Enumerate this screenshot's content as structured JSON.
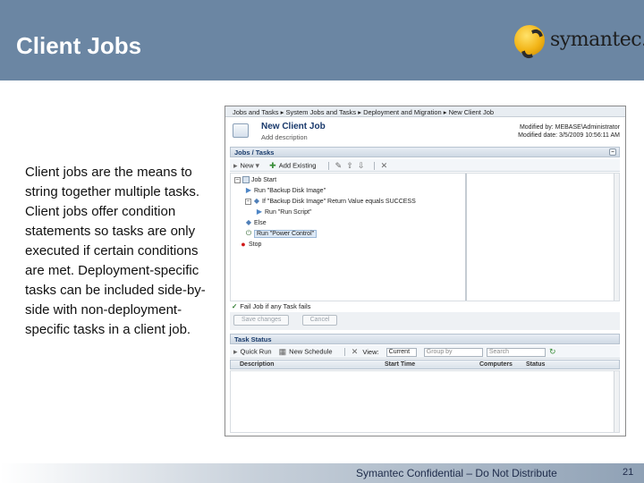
{
  "slide": {
    "title": "Client Jobs",
    "logo_text": "symantec.",
    "body": "Client jobs are the means to string together multiple tasks. Client jobs offer condition statements so tasks are only executed if certain conditions are met. Deployment-specific tasks can be included side-by-side with non-deployment-specific tasks in a client job.",
    "footer": "Symantec Confidential – Do Not Distribute",
    "page_number": "21"
  },
  "app": {
    "breadcrumb": [
      "Jobs and Tasks",
      "System Jobs and Tasks",
      "Deployment and Migration",
      "New Client Job"
    ],
    "breadcrumb_separator": "▸",
    "job": {
      "name": "New Client Job",
      "description_placeholder": "Add description",
      "modified_by": "Modified by: MEBASE\\Administrator",
      "modified_date": "Modified date: 3/5/2009 10:56:11 AM"
    },
    "jobs_section": {
      "title": "Jobs / Tasks",
      "toolbar": {
        "new_label": "New",
        "add_existing_label": "Add Existing"
      },
      "tree": [
        {
          "label": "Job Start"
        },
        {
          "label": "Run \"Backup Disk Image\""
        },
        {
          "label": "If \"Backup Disk Image\" Return Value equals SUCCESS"
        },
        {
          "label": "Run \"Run Script\""
        },
        {
          "label": "Else"
        },
        {
          "label": "Run \"Power Control\""
        },
        {
          "label": "Stop"
        }
      ],
      "fail_label": "Fail Job if any Task fails",
      "save_label": "Save changes",
      "cancel_label": "Cancel"
    },
    "task_status": {
      "title": "Task Status",
      "quick_run_label": "Quick Run",
      "new_schedule_label": "New Schedule",
      "view_label": "View:",
      "view_value": "Current",
      "group_by_placeholder": "Group by",
      "search_placeholder": "Search",
      "columns": [
        "Description",
        "Start Time",
        "Computers",
        "Status"
      ]
    }
  }
}
